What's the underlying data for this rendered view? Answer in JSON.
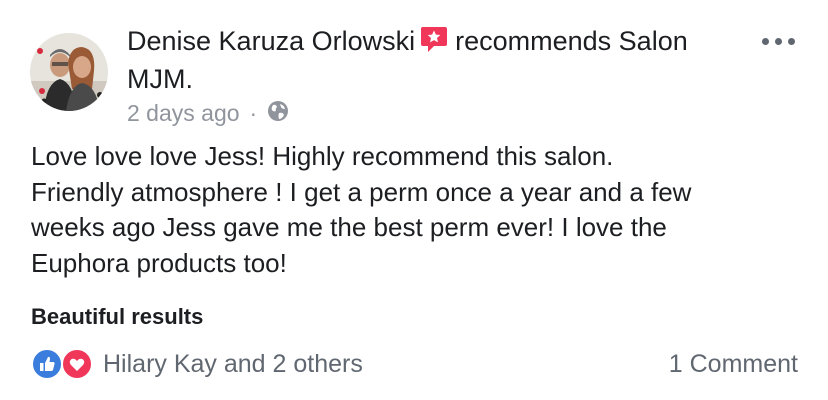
{
  "post": {
    "author": "Denise Karuza Orlowski",
    "action_text": "recommends Salon MJM.",
    "timestamp": "2 days ago",
    "separator": "·",
    "privacy_icon": "globe-icon",
    "recommend_icon": "recommend-star-icon",
    "more_icon": "more-options-icon",
    "text_lines": [
      "Love love love Jess!   Highly recommend this salon.",
      "Friendly atmosphere !  I get a perm once a year and a few",
      "weeks ago Jess gave me the best perm ever!  I love the",
      "Euphora products too!"
    ],
    "tag": "Beautiful results"
  },
  "footer": {
    "reactions": [
      "like-icon",
      "love-icon"
    ],
    "reactors": "Hilary Kay and 2 others",
    "comments": "1 Comment"
  },
  "colors": {
    "text": "#1c1e21",
    "meta": "#90949c",
    "recommend": "#f0375a",
    "like": "#3b7ddd",
    "love": "#f0375a"
  }
}
